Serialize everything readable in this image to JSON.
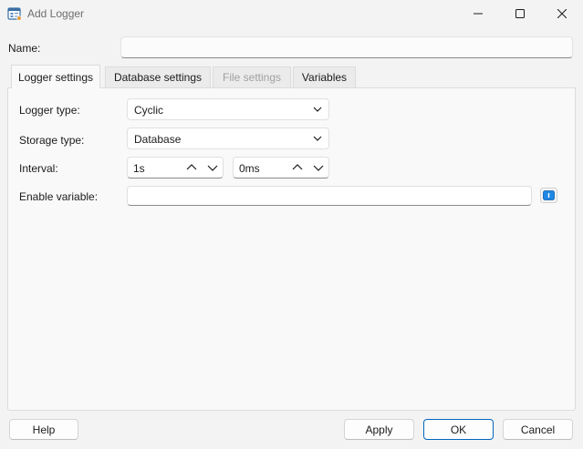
{
  "window": {
    "title": "Add Logger",
    "icon": "logger-app-icon",
    "controls": [
      "minimize-icon",
      "maximize-icon",
      "close-icon"
    ]
  },
  "form": {
    "name_label": "Name:",
    "name_value": ""
  },
  "tabs": [
    {
      "label": "Logger settings",
      "state": "active"
    },
    {
      "label": "Database settings",
      "state": "normal"
    },
    {
      "label": "File settings",
      "state": "disabled"
    },
    {
      "label": "Variables",
      "state": "normal"
    }
  ],
  "logger_settings": {
    "logger_type": {
      "label": "Logger type:",
      "value": "Cyclic"
    },
    "storage_type": {
      "label": "Storage type:",
      "value": "Database"
    },
    "interval": {
      "label": "Interval:",
      "primary": "1s",
      "secondary": "0ms"
    },
    "enable_variable": {
      "label": "Enable variable:",
      "value": "",
      "button_icon": "variable-picker-icon"
    }
  },
  "buttons": {
    "help": "Help",
    "apply": "Apply",
    "ok": "OK",
    "cancel": "Cancel"
  },
  "colors": {
    "accent": "#0067c0",
    "window_bg": "#f3f3f3",
    "panel_bg": "#f9f9f9"
  }
}
